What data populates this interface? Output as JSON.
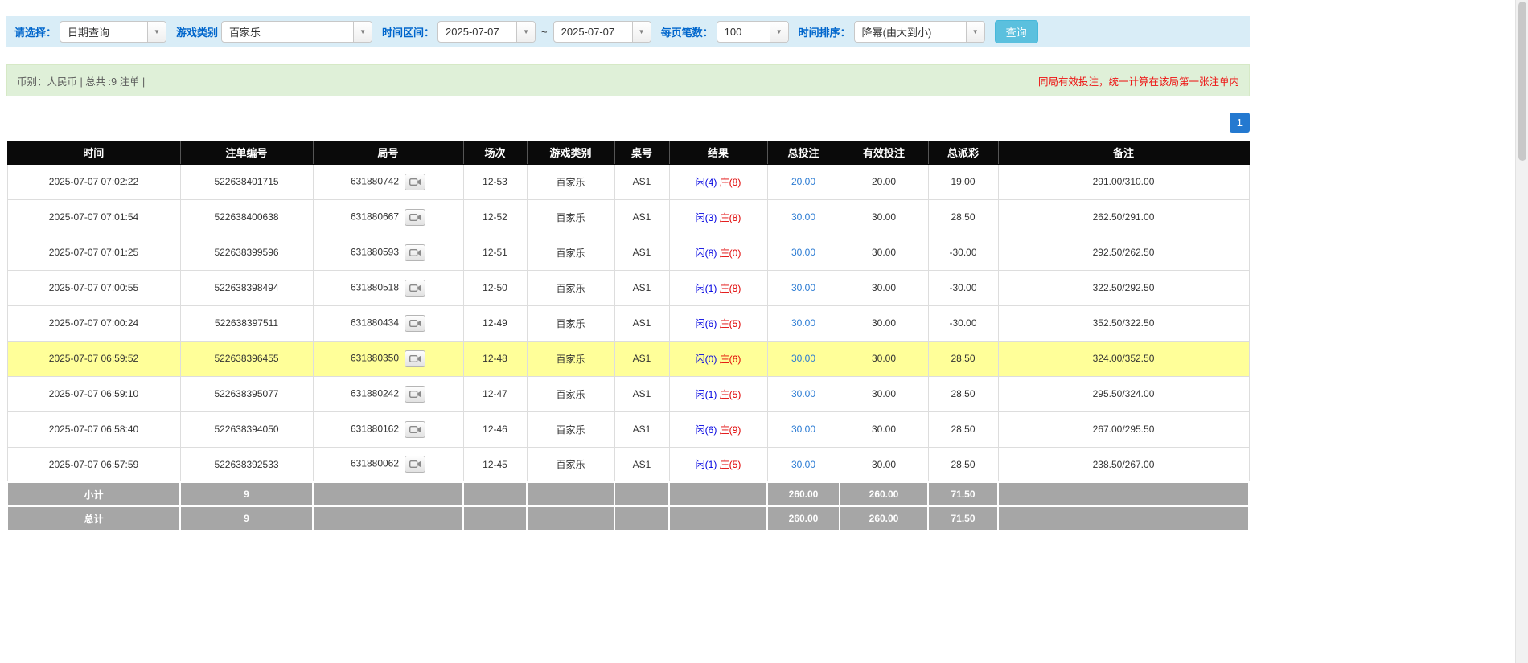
{
  "filter": {
    "label_select": "请选择：",
    "value_query_type": "日期查询",
    "label_game": "游戏类别",
    "value_game": "百家乐",
    "label_range": "时间区间：",
    "value_date_from": "2025-07-07",
    "range_separator": "~",
    "value_date_to": "2025-07-07",
    "label_per_page": "每页笔数：",
    "value_per_page": "100",
    "label_sort": "时间排序：",
    "value_sort": "降幂(由大到小)",
    "button_query": "查询"
  },
  "summary": {
    "left": "币别：人民币 | 总共 :9 注单 |",
    "right": "同局有效投注，统一计算在该局第一张注单内"
  },
  "pagination": {
    "current": "1"
  },
  "table": {
    "headers": [
      "时间",
      "注单编号",
      "局号",
      "场次",
      "游戏类别",
      "桌号",
      "结果",
      "总投注",
      "有效投注",
      "总派彩",
      "备注"
    ],
    "rows": [
      {
        "time": "2025-07-07 07:02:22",
        "bet_id": "522638401715",
        "round_id": "631880742",
        "session": "12-53",
        "game": "百家乐",
        "table_no": "AS1",
        "result_player": "闲(4)",
        "result_banker": "庄(8)",
        "total_bet": "20.00",
        "valid_bet": "20.00",
        "payout": "19.00",
        "remark": "291.00/310.00",
        "highlighted": false
      },
      {
        "time": "2025-07-07 07:01:54",
        "bet_id": "522638400638",
        "round_id": "631880667",
        "session": "12-52",
        "game": "百家乐",
        "table_no": "AS1",
        "result_player": "闲(3)",
        "result_banker": "庄(8)",
        "total_bet": "30.00",
        "valid_bet": "30.00",
        "payout": "28.50",
        "remark": "262.50/291.00",
        "highlighted": false
      },
      {
        "time": "2025-07-07 07:01:25",
        "bet_id": "522638399596",
        "round_id": "631880593",
        "session": "12-51",
        "game": "百家乐",
        "table_no": "AS1",
        "result_player": "闲(8)",
        "result_banker": "庄(0)",
        "total_bet": "30.00",
        "valid_bet": "30.00",
        "payout": "-30.00",
        "remark": "292.50/262.50",
        "highlighted": false
      },
      {
        "time": "2025-07-07 07:00:55",
        "bet_id": "522638398494",
        "round_id": "631880518",
        "session": "12-50",
        "game": "百家乐",
        "table_no": "AS1",
        "result_player": "闲(1)",
        "result_banker": "庄(8)",
        "total_bet": "30.00",
        "valid_bet": "30.00",
        "payout": "-30.00",
        "remark": "322.50/292.50",
        "highlighted": false
      },
      {
        "time": "2025-07-07 07:00:24",
        "bet_id": "522638397511",
        "round_id": "631880434",
        "session": "12-49",
        "game": "百家乐",
        "table_no": "AS1",
        "result_player": "闲(6)",
        "result_banker": "庄(5)",
        "total_bet": "30.00",
        "valid_bet": "30.00",
        "payout": "-30.00",
        "remark": "352.50/322.50",
        "highlighted": false
      },
      {
        "time": "2025-07-07 06:59:52",
        "bet_id": "522638396455",
        "round_id": "631880350",
        "session": "12-48",
        "game": "百家乐",
        "table_no": "AS1",
        "result_player": "闲(0)",
        "result_banker": "庄(6)",
        "total_bet": "30.00",
        "valid_bet": "30.00",
        "payout": "28.50",
        "remark": "324.00/352.50",
        "highlighted": true
      },
      {
        "time": "2025-07-07 06:59:10",
        "bet_id": "522638395077",
        "round_id": "631880242",
        "session": "12-47",
        "game": "百家乐",
        "table_no": "AS1",
        "result_player": "闲(1)",
        "result_banker": "庄(5)",
        "total_bet": "30.00",
        "valid_bet": "30.00",
        "payout": "28.50",
        "remark": "295.50/324.00",
        "highlighted": false
      },
      {
        "time": "2025-07-07 06:58:40",
        "bet_id": "522638394050",
        "round_id": "631880162",
        "session": "12-46",
        "game": "百家乐",
        "table_no": "AS1",
        "result_player": "闲(6)",
        "result_banker": "庄(9)",
        "total_bet": "30.00",
        "valid_bet": "30.00",
        "payout": "28.50",
        "remark": "267.00/295.50",
        "highlighted": false
      },
      {
        "time": "2025-07-07 06:57:59",
        "bet_id": "522638392533",
        "round_id": "631880062",
        "session": "12-45",
        "game": "百家乐",
        "table_no": "AS1",
        "result_player": "闲(1)",
        "result_banker": "庄(5)",
        "total_bet": "30.00",
        "valid_bet": "30.00",
        "payout": "28.50",
        "remark": "238.50/267.00",
        "highlighted": false
      }
    ],
    "subtotal": {
      "label": "小计",
      "count": "9",
      "total_bet": "260.00",
      "valid_bet": "260.00",
      "payout": "71.50"
    },
    "total": {
      "label": "总计",
      "count": "9",
      "total_bet": "260.00",
      "valid_bet": "260.00",
      "payout": "71.50"
    }
  }
}
